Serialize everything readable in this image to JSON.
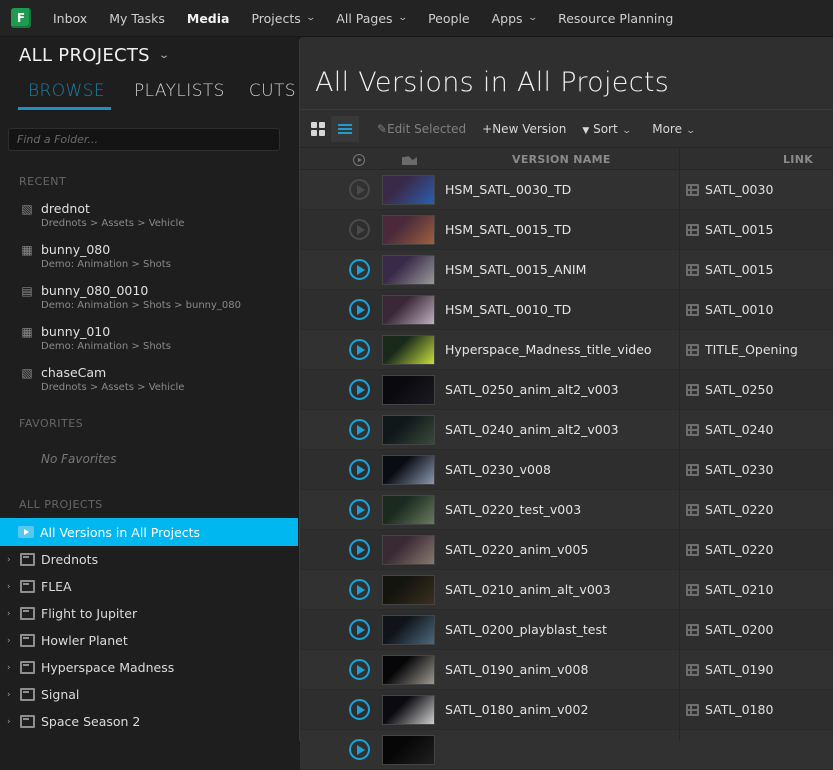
{
  "topnav": {
    "logo_letter": "F",
    "items": [
      {
        "label": "Inbox",
        "dropdown": false,
        "active": false
      },
      {
        "label": "My Tasks",
        "dropdown": false,
        "active": false
      },
      {
        "label": "Media",
        "dropdown": false,
        "active": true
      },
      {
        "label": "Projects",
        "dropdown": true,
        "active": false
      },
      {
        "label": "All Pages",
        "dropdown": true,
        "active": false
      },
      {
        "label": "People",
        "dropdown": false,
        "active": false
      },
      {
        "label": "Apps",
        "dropdown": true,
        "active": false
      },
      {
        "label": "Resource Planning",
        "dropdown": false,
        "active": false
      }
    ]
  },
  "sidebar": {
    "project_selector": "ALL PROJECTS",
    "tabs": [
      {
        "label": "BROWSE",
        "active": true
      },
      {
        "label": "PLAYLISTS",
        "active": false
      },
      {
        "label": "CUTS",
        "active": false
      }
    ],
    "find_placeholder": "Find a Folder...",
    "recent_label": "RECENT",
    "recent": [
      {
        "name": "drednot",
        "path": "Drednots > Assets > Vehicle",
        "icon": "asset-cube-icon"
      },
      {
        "name": "bunny_080",
        "path": "Demo: Animation > Shots",
        "icon": "sequence-icon"
      },
      {
        "name": "bunny_080_0010",
        "path": "Demo: Animation > Shots > bunny_080",
        "icon": "shot-film-icon"
      },
      {
        "name": "bunny_010",
        "path": "Demo: Animation > Shots",
        "icon": "sequence-icon"
      },
      {
        "name": "chaseCam",
        "path": "Drednots > Assets > Vehicle",
        "icon": "asset-cube-icon"
      }
    ],
    "favorites_label": "FAVORITES",
    "no_favorites": "No Favorites",
    "all_projects_label": "ALL PROJECTS",
    "selected_item": "All Versions in All Projects",
    "projects": [
      "Drednots",
      "FLEA",
      "Flight to Jupiter",
      "Howler Planet",
      "Hyperspace Madness",
      "Signal",
      "Space Season 2"
    ]
  },
  "main": {
    "title": "All Versions in All Projects",
    "toolbar": {
      "edit_selected": "Edit Selected",
      "new_version": "New Version",
      "sort": "Sort",
      "more": "More"
    },
    "columns": {
      "version_name": "VERSION NAME",
      "link": "LINK"
    },
    "rows": [
      {
        "name": "HSM_SATL_0030_TD",
        "link": "SATL_0030",
        "playable": false,
        "thumb": [
          "#3a2a4a",
          "#2a5fb0"
        ]
      },
      {
        "name": "HSM_SATL_0015_TD",
        "link": "SATL_0015",
        "playable": false,
        "thumb": [
          "#4a2a3a",
          "#a06040"
        ]
      },
      {
        "name": "HSM_SATL_0015_ANIM",
        "link": "SATL_0015",
        "playable": true,
        "thumb": [
          "#3a2a4a",
          "#9a9a9a"
        ]
      },
      {
        "name": "HSM_SATL_0010_TD",
        "link": "SATL_0010",
        "playable": true,
        "thumb": [
          "#3a2838",
          "#c0b0c0"
        ]
      },
      {
        "name": "Hyperspace_Madness_title_video",
        "link": "TITLE_Opening",
        "playable": true,
        "thumb": [
          "#1a2a1a",
          "#c8e040"
        ]
      },
      {
        "name": "SATL_0250_anim_alt2_v003",
        "link": "SATL_0250",
        "playable": true,
        "thumb": [
          "#0a0a0e",
          "#1a1a22"
        ]
      },
      {
        "name": "SATL_0240_anim_alt2_v003",
        "link": "SATL_0240",
        "playable": true,
        "thumb": [
          "#10181a",
          "#3a4a3a"
        ]
      },
      {
        "name": "SATL_0230_v008",
        "link": "SATL_0230",
        "playable": true,
        "thumb": [
          "#0a0c14",
          "#8a9ab0"
        ]
      },
      {
        "name": "SATL_0220_test_v003",
        "link": "SATL_0220",
        "playable": true,
        "thumb": [
          "#1a2a1e",
          "#6a7a60"
        ]
      },
      {
        "name": "SATL_0220_anim_v005",
        "link": "SATL_0220",
        "playable": true,
        "thumb": [
          "#3a2a34",
          "#8a7a70"
        ]
      },
      {
        "name": "SATL_0210_anim_alt_v003",
        "link": "SATL_0210",
        "playable": true,
        "thumb": [
          "#14140e",
          "#3a3020"
        ]
      },
      {
        "name": "SATL_0200_playblast_test",
        "link": "SATL_0200",
        "playable": true,
        "thumb": [
          "#10141a",
          "#4a6a80"
        ]
      },
      {
        "name": "SATL_0190_anim_v008",
        "link": "SATL_0190",
        "playable": true,
        "thumb": [
          "#060608",
          "#a09a90"
        ]
      },
      {
        "name": "SATL_0180_anim_v002",
        "link": "SATL_0180",
        "playable": true,
        "thumb": [
          "#0a0a10",
          "#d0d0d0"
        ]
      },
      {
        "name": "",
        "link": "",
        "playable": true,
        "thumb": [
          "#060606",
          "#202020"
        ]
      }
    ]
  },
  "colors": {
    "accent": "#1ea2d6",
    "selected_bg": "#00b7f0",
    "logo_green": "#1f9b4f"
  }
}
